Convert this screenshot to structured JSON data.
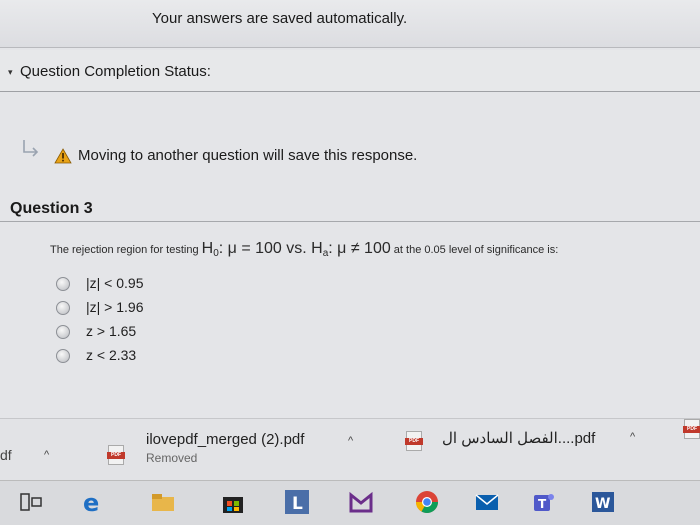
{
  "header": {
    "saved_message": "Your answers are saved automatically."
  },
  "status": {
    "chevron": "▾",
    "label": "Question Completion Status:"
  },
  "notice": {
    "icon_arrow": "return-arrow-icon",
    "icon_warning": "warning-icon",
    "message": "Moving to another question will save this response."
  },
  "question": {
    "title": "Question 3",
    "stem": {
      "prefix": "The rejection region for testing ",
      "h0": "H",
      "h0_sub": "0",
      "h0_rest": ":  μ = 100 vs. ",
      "ha": "H",
      "ha_sub": "a",
      "ha_rest": ":  μ ≠ 100",
      "suffix": " at the 0.05 level of significance is:"
    },
    "options": [
      {
        "label": "|z| < 0.95"
      },
      {
        "label": "|z| > 1.96"
      },
      {
        "label": "z > 1.65"
      },
      {
        "label": "z < 2.33"
      }
    ]
  },
  "downloads": {
    "partial_left": "df",
    "items": [
      {
        "name": "ilovepdf_merged (2).pdf",
        "status": "Removed"
      },
      {
        "name": "الفصل السادس ال....pdf"
      }
    ],
    "pdf_badge": "PDF",
    "caret": "^"
  },
  "taskbar": {
    "icons": [
      "task-view-icon",
      "edge-icon",
      "file-explorer-icon",
      "store-icon",
      "app-l-icon",
      "app-m-icon",
      "chrome-icon",
      "mail-icon",
      "teams-icon",
      "word-icon"
    ],
    "app_l_letter": "L",
    "teams_letter": "T",
    "word_letter": "W"
  }
}
